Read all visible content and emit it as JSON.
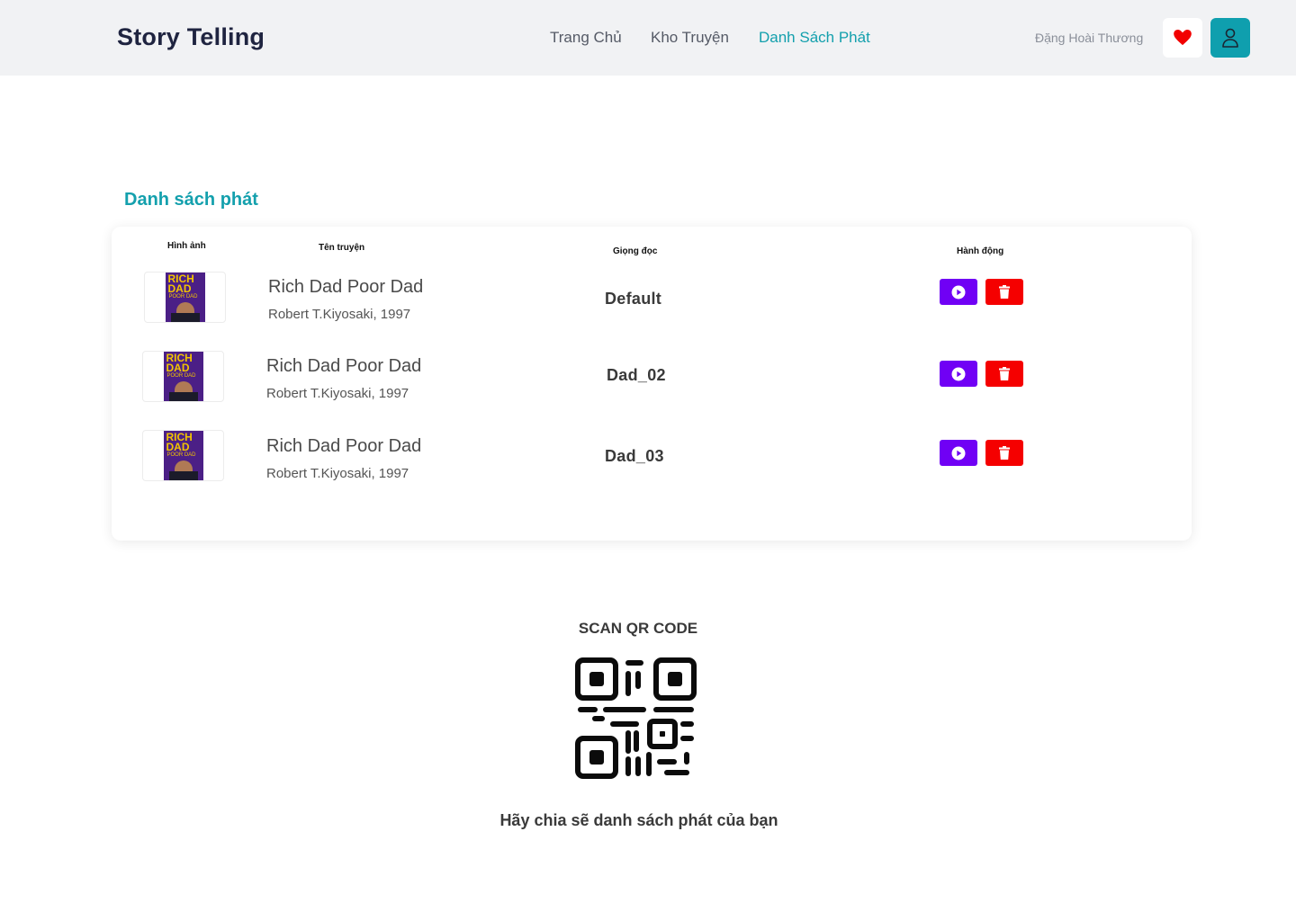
{
  "header": {
    "brand": "Story Telling",
    "nav": [
      "Trang Chủ",
      "Kho Truyện",
      "Danh Sách Phát"
    ],
    "active_nav": "Danh Sách Phát",
    "username": "Đặng Hoài Thương",
    "favorite_icon": "heart-icon",
    "profile_icon": "user-icon",
    "accent_color": "#14a0ad"
  },
  "playlist": {
    "title": "Danh sách phát",
    "columns": [
      "Hình ảnh",
      "Tên truyện",
      "Giọng đọc",
      "Hành động"
    ],
    "rows": [
      {
        "cover_text": "RICH DAD",
        "cover_sub": "POOR DAD",
        "title": "Rich Dad Poor Dad",
        "author": "Robert T.Kiyosaki, 1997",
        "voice": "Default"
      },
      {
        "cover_text": "RICH DAD",
        "cover_sub": "POOR DAD",
        "title": "Rich Dad Poor Dad",
        "author": "Robert T.Kiyosaki, 1997",
        "voice": "Dad_02"
      },
      {
        "cover_text": "RICH DAD",
        "cover_sub": "POOR DAD",
        "title": "Rich Dad Poor Dad",
        "author": "Robert T.Kiyosaki, 1997",
        "voice": "Dad_03"
      }
    ],
    "play_icon": "play-icon",
    "delete_icon": "trash-icon",
    "play_color": "#7000f5",
    "delete_color": "#f50000"
  },
  "qr": {
    "title": "SCAN QR CODE",
    "share_text": "Hãy chia sẽ danh sách phát của bạn"
  }
}
